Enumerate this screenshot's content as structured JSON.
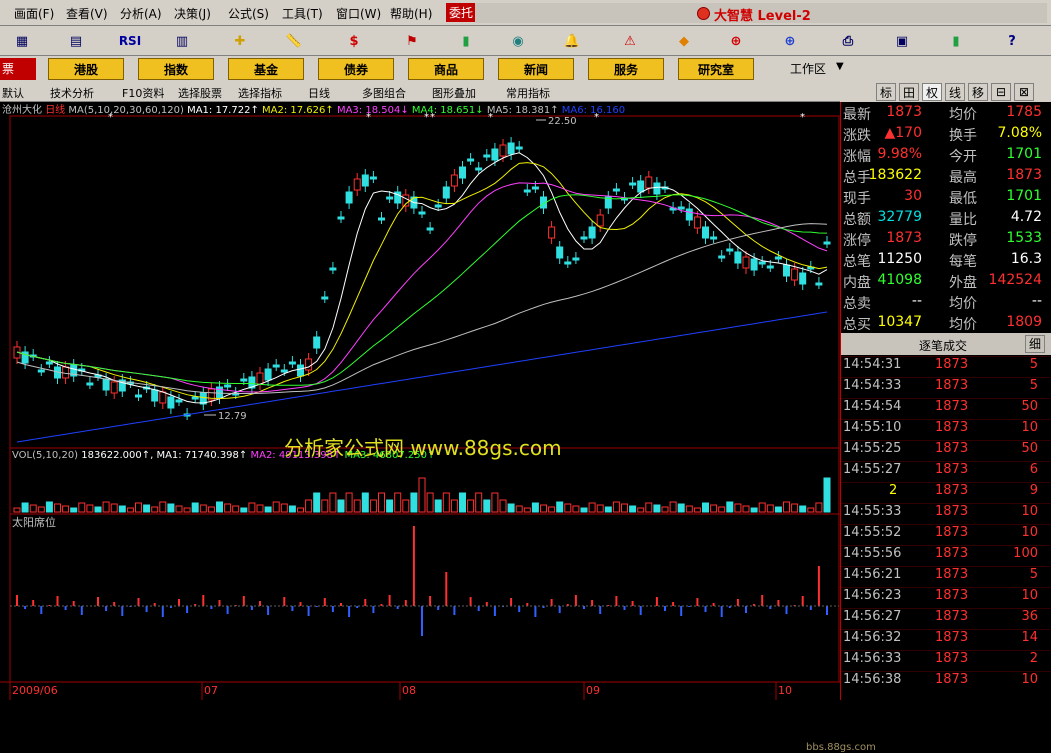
{
  "menu": {
    "items": [
      "画面(F)",
      "查看(V)",
      "分析(A)",
      "决策(J)",
      "公式(S)",
      "工具(T)",
      "窗口(W)",
      "帮助(H)"
    ],
    "weituo": "委托",
    "brand": "大智慧 Level-2"
  },
  "toolbar": {
    "icons": [
      "chart-icon",
      "kline-icon",
      "rsi-icon",
      "report-icon",
      "crosshair-icon",
      "ruler-icon",
      "dollar-icon",
      "flag-icon",
      "bars-icon",
      "binocular-icon",
      "bell-icon",
      "warning-icon",
      "diamond-icon",
      "zoom-red-icon",
      "zoom-blue-icon",
      "print-icon",
      "window-icon",
      "stats-icon",
      "help-icon"
    ],
    "rsi_label": "RSI"
  },
  "nav": {
    "left": "票",
    "items": [
      "港股",
      "指数",
      "基金",
      "债券",
      "商品",
      "新闻",
      "服务",
      "研究室"
    ],
    "workspace": "工作区"
  },
  "funcbar": {
    "items": [
      "默认",
      "技术分析",
      "F10资料",
      "选择股票",
      "选择指标",
      "日线",
      "多图组合",
      "图形叠加",
      "常用指标"
    ]
  },
  "righttabs": [
    "标",
    "田",
    "权",
    "线",
    "移",
    "⊟",
    "⊠"
  ],
  "chart": {
    "stock": "沧州大化",
    "period": "日线",
    "ma_label": "MA(5,10,20,30,60,120)",
    "ma": [
      {
        "name": "MA1",
        "value": "17.722↑",
        "color": "#ffffff"
      },
      {
        "name": "MA2",
        "value": "17.626↑",
        "color": "#f0f000"
      },
      {
        "name": "MA3",
        "value": "18.504↓",
        "color": "#ff40ff"
      },
      {
        "name": "MA4",
        "value": "18.651↓",
        "color": "#30ff30"
      },
      {
        "name": "MA5",
        "value": "18.381↑",
        "color": "#c0c0c0"
      },
      {
        "name": "MA6",
        "value": "16.160",
        "color": "#2040ff"
      }
    ],
    "high_mark": "22.50",
    "low_mark": "12.79",
    "vol_label": "VOL(5,10,20)",
    "vol_value": "183622.000↑",
    "vol_ma": [
      {
        "name": "MA1",
        "value": "71740.398↑",
        "color": "#ffffff"
      },
      {
        "name": "MA2",
        "value": "49113.398↑",
        "color": "#ff40ff"
      },
      {
        "name": "MA3",
        "value": "46807.250↑",
        "color": "#30ff30"
      }
    ],
    "indicator": "太阳席位",
    "dates": [
      "2009/06",
      "07",
      "08",
      "09",
      "10"
    ],
    "watermark": "分析家公式网 www.88gs.com",
    "watermark2": "bbs.88gs.com"
  },
  "quote": {
    "rows": [
      {
        "l": "最新",
        "v": "1873",
        "vc": "#ff3030",
        "l2": "均价",
        "v2": "1785",
        "v2c": "#ff3030"
      },
      {
        "l": "涨跌",
        "v": "▲170",
        "vc": "#ff3030",
        "l2": "换手",
        "v2": "7.08%",
        "v2c": "#ffff00"
      },
      {
        "l": "涨幅",
        "v": "9.98%",
        "vc": "#ff3030",
        "l2": "今开",
        "v2": "1701",
        "v2c": "#30ff30"
      },
      {
        "l": "总手",
        "v": "183622",
        "vc": "#ffff00",
        "l2": "最高",
        "v2": "1873",
        "v2c": "#ff3030"
      },
      {
        "l": "现手",
        "v": "30",
        "vc": "#ff3030",
        "l2": "最低",
        "v2": "1701",
        "v2c": "#30ff30"
      },
      {
        "l": "总额",
        "v": "32779",
        "vc": "#00e0e0",
        "l2": "量比",
        "v2": "4.72",
        "v2c": "#ffffff"
      },
      {
        "l": "涨停",
        "v": "1873",
        "vc": "#ff3030",
        "l2": "跌停",
        "v2": "1533",
        "v2c": "#30ff30"
      },
      {
        "l": "总笔",
        "v": "11250",
        "vc": "#ffffff",
        "l2": "每笔",
        "v2": "16.3",
        "v2c": "#ffffff"
      },
      {
        "l": "内盘",
        "v": "41098",
        "vc": "#30ff30",
        "l2": "外盘",
        "v2": "142524",
        "v2c": "#ff3030"
      },
      {
        "l": "总卖",
        "v": "--",
        "vc": "#ffffff",
        "l2": "均价",
        "v2": "--",
        "v2c": "#ffffff"
      },
      {
        "l": "总买",
        "v": "10347",
        "vc": "#ffff00",
        "l2": "均价",
        "v2": "1809",
        "v2c": "#ff3030"
      }
    ],
    "trades_title": "逐笔成交",
    "trades_btn": "细",
    "trades": [
      {
        "t": "14:54:31",
        "p": "1873",
        "v": "5"
      },
      {
        "t": "14:54:33",
        "p": "1873",
        "v": "5"
      },
      {
        "t": "14:54:54",
        "p": "1873",
        "v": "50"
      },
      {
        "t": "14:55:10",
        "p": "1873",
        "v": "10"
      },
      {
        "t": "14:55:25",
        "p": "1873",
        "v": "50"
      },
      {
        "t": "14:55:27",
        "p": "1873",
        "v": "6"
      },
      {
        "t": "2",
        "p": "1873",
        "v": "9"
      },
      {
        "t": "14:55:33",
        "p": "1873",
        "v": "10"
      },
      {
        "t": "14:55:52",
        "p": "1873",
        "v": "10"
      },
      {
        "t": "14:55:56",
        "p": "1873",
        "v": "100"
      },
      {
        "t": "14:56:21",
        "p": "1873",
        "v": "5"
      },
      {
        "t": "14:56:23",
        "p": "1873",
        "v": "10"
      },
      {
        "t": "14:56:27",
        "p": "1873",
        "v": "36"
      },
      {
        "t": "14:56:32",
        "p": "1873",
        "v": "14"
      },
      {
        "t": "14:56:33",
        "p": "1873",
        "v": "2"
      },
      {
        "t": "14:56:38",
        "p": "1873",
        "v": "10"
      }
    ]
  }
}
